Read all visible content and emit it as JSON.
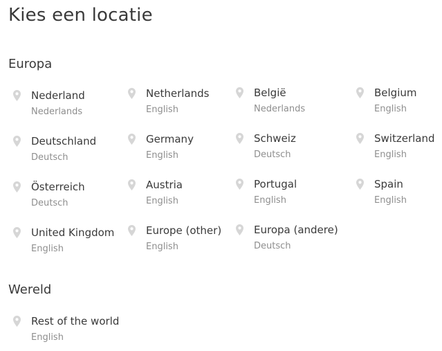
{
  "page": {
    "title": "Kies een locatie"
  },
  "colors": {
    "text": "#3a3a3a",
    "muted": "#8e8e8e",
    "pin": "#d6d6d6"
  },
  "europe": {
    "title": "Europa",
    "locations": [
      {
        "name": "Nederland",
        "language": "Nederlands"
      },
      {
        "name": "Netherlands",
        "language": "English"
      },
      {
        "name": "België",
        "language": "Nederlands"
      },
      {
        "name": "Belgium",
        "language": "English"
      },
      {
        "name": "Deutschland",
        "language": "Deutsch"
      },
      {
        "name": "Germany",
        "language": "English"
      },
      {
        "name": "Schweiz",
        "language": "Deutsch"
      },
      {
        "name": "Switzerland",
        "language": "English"
      },
      {
        "name": "Österreich",
        "language": "Deutsch"
      },
      {
        "name": "Austria",
        "language": "English"
      },
      {
        "name": "Portugal",
        "language": "English"
      },
      {
        "name": "Spain",
        "language": "English"
      },
      {
        "name": "United Kingdom",
        "language": "English"
      },
      {
        "name": "Europe (other)",
        "language": "English"
      },
      {
        "name": "Europa (andere)",
        "language": "Deutsch"
      }
    ]
  },
  "world": {
    "title": "Wereld",
    "locations": [
      {
        "name": "Rest of the world",
        "language": "English"
      }
    ]
  },
  "icons": {
    "location": "map-pin-icon"
  }
}
